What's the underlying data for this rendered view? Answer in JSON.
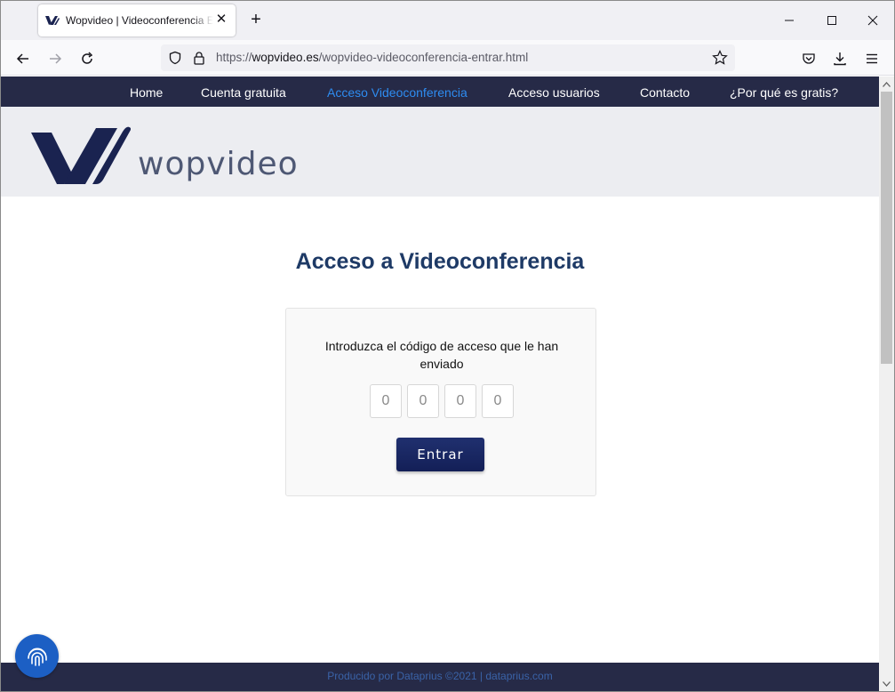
{
  "browser": {
    "tab_title": "Wopvideo | Videoconferencia Entrar",
    "url_prefix": "https://",
    "url_host": "wopvideo.es",
    "url_path": "/wopvideo-videoconferencia-entrar.html"
  },
  "nav": {
    "items": [
      {
        "label": "Home"
      },
      {
        "label": "Cuenta gratuita"
      },
      {
        "label": "Acceso Videoconferencia",
        "active": true
      },
      {
        "label": "Acceso usuarios"
      },
      {
        "label": "Contacto"
      },
      {
        "label": "¿Por qué es gratis?"
      }
    ]
  },
  "hero": {
    "logo_text": "wopvideo"
  },
  "main": {
    "title": "Acceso a Videoconferencia",
    "instructions": "Introduzca el código de acceso que le han enviado",
    "code_placeholders": [
      "0",
      "0",
      "0",
      "0"
    ],
    "submit_label": "Entrar"
  },
  "footer": {
    "text": "Producido por Dataprius ©2021 | dataprius.com"
  },
  "colors": {
    "nav_bg": "#262a47",
    "nav_active": "#2e8cf0",
    "title": "#1e3a66",
    "button": "#1a2a6c",
    "fingerprint_button": "#1c5fc4"
  }
}
